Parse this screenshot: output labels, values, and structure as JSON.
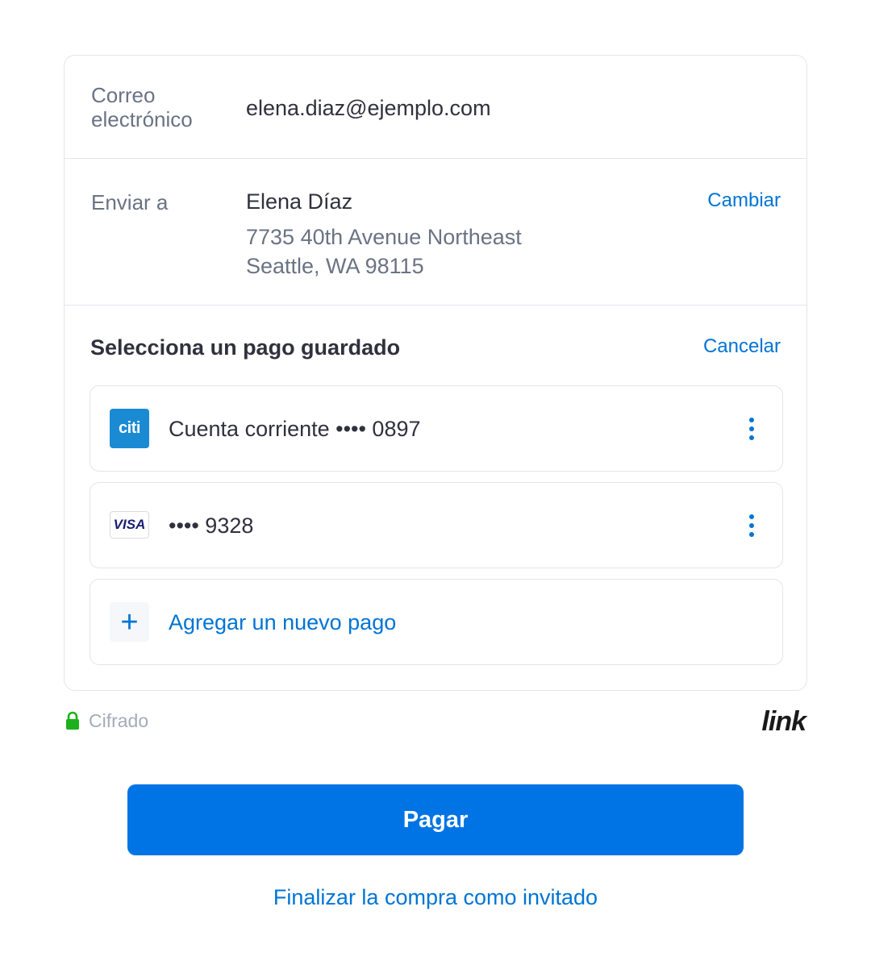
{
  "email": {
    "label": "Correo electrónico",
    "value": "elena.diaz@ejemplo.com"
  },
  "shipping": {
    "label": "Enviar a",
    "name": "Elena Díaz",
    "address_line1": "7735 40th Avenue Northeast",
    "address_line2": "Seattle, WA 98115",
    "change_label": "Cambiar"
  },
  "payment": {
    "title": "Selecciona un pago guardado",
    "cancel_label": "Cancelar",
    "methods": [
      {
        "icon": "citi-bank-icon",
        "logo_text": "citi",
        "label": "Cuenta corriente •••• 0897"
      },
      {
        "icon": "visa-card-icon",
        "logo_text": "VISA",
        "label": "•••• 9328"
      }
    ],
    "add_label": "Agregar un nuevo pago",
    "add_icon_glyph": "+"
  },
  "footer": {
    "encrypted_label": "Cifrado",
    "brand_logo_text": "link"
  },
  "pay_button_label": "Pagar",
  "guest_checkout_label": "Finalizar la compra como invitado",
  "colors": {
    "accent": "#0074d4",
    "button": "#0074e4",
    "lock": "#1cb11c"
  }
}
